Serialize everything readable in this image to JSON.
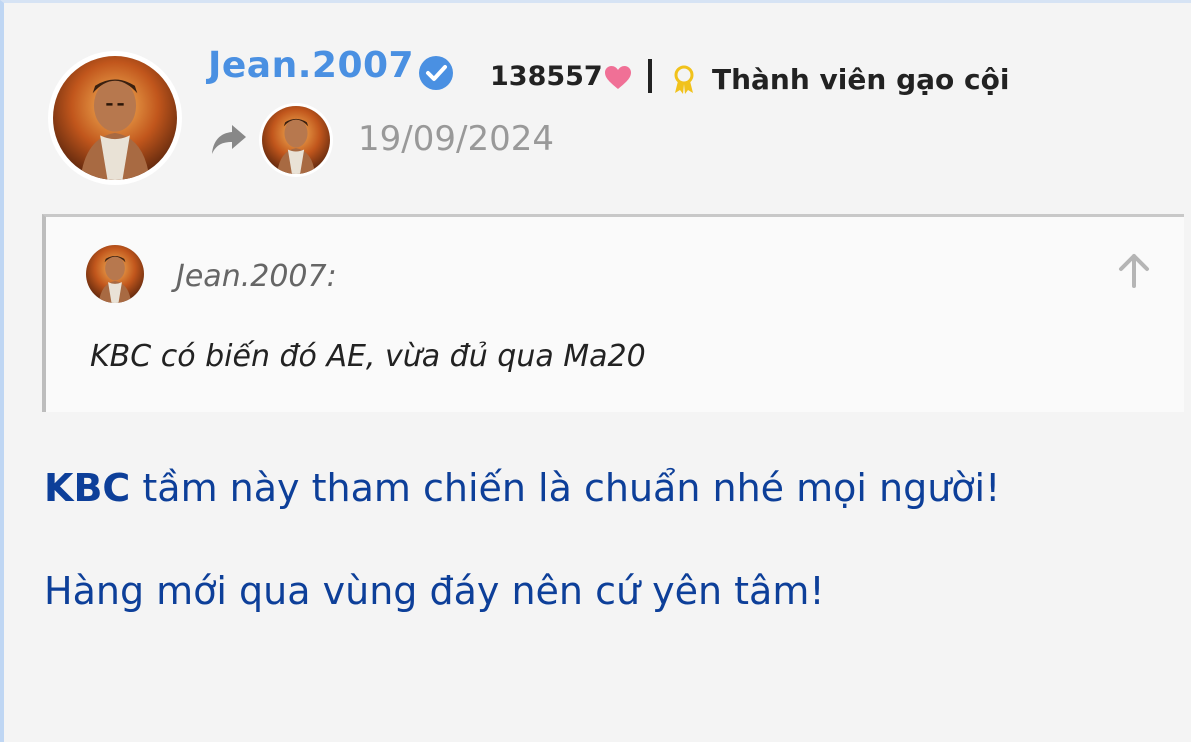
{
  "post": {
    "author": {
      "name": "Jean.2007",
      "verified": true,
      "avatar": "bare-chested-man-fire-background-avatar"
    },
    "likes": "138557",
    "rank": "Thành viên gạo cội",
    "date": "19/09/2024",
    "icons": {
      "verified": "verified-check-icon",
      "heart": "heart-icon",
      "badge": "award-ribbon-icon",
      "share": "share-forward-icon",
      "scroll_up": "arrow-up-icon"
    },
    "colors": {
      "username": "#4a90e2",
      "body_text": "#0d3f99",
      "heart": "#f07096",
      "badge": "#f1c21b"
    }
  },
  "quote": {
    "author": "Jean.2007:",
    "text": "KBC có biến đó AE, vừa đủ qua Ma20"
  },
  "body": {
    "line1_ticker": "KBC",
    "line1_rest": " tầm này tham chiến là chuẩn nhé mọi người!",
    "line2": "Hàng mới qua vùng đáy nên cứ yên tâm!"
  }
}
